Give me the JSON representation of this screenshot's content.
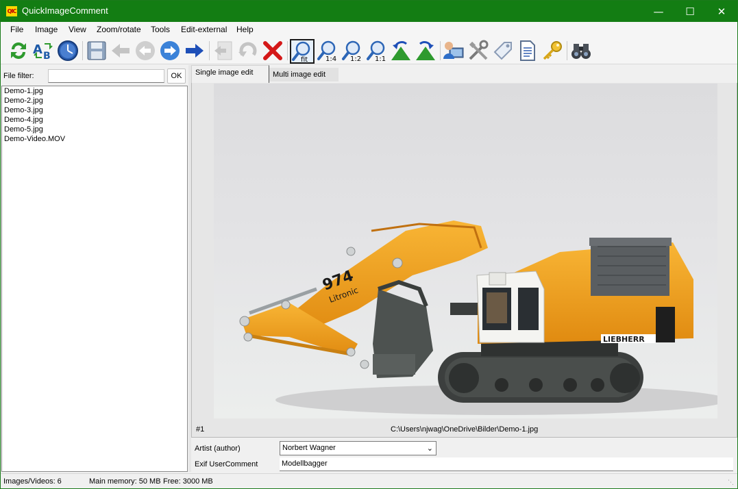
{
  "window": {
    "title": "QuickImageComment",
    "app_icon_text": "QIC",
    "minimize": "—",
    "maximize": "☐",
    "close": "✕"
  },
  "menu": {
    "items": [
      "File",
      "Image",
      "View",
      "Zoom/rotate",
      "Tools",
      "Edit-external",
      "Help"
    ]
  },
  "toolbar": {
    "buttons": [
      {
        "icon": "refresh-icon"
      },
      {
        "icon": "rename-icon"
      },
      {
        "icon": "clock-icon"
      },
      {
        "icon": "save-icon",
        "disabled": false
      },
      {
        "icon": "previous-arrow-icon",
        "disabled": true
      },
      {
        "icon": "previous-circle-icon",
        "disabled": true
      },
      {
        "icon": "next-circle-icon"
      },
      {
        "icon": "next-arrow-icon"
      },
      {
        "icon": "first-icon",
        "disabled": true
      },
      {
        "icon": "undo-icon",
        "disabled": true
      },
      {
        "icon": "delete-icon"
      },
      {
        "icon": "zoom-fit-icon",
        "label": "fit",
        "active": true
      },
      {
        "icon": "zoom-1-4-icon",
        "label": "1:4"
      },
      {
        "icon": "zoom-1-2-icon",
        "label": "1:2"
      },
      {
        "icon": "zoom-1-1-icon",
        "label": "1:1"
      },
      {
        "icon": "rotate-left-icon"
      },
      {
        "icon": "rotate-right-icon"
      },
      {
        "icon": "user-settings-icon"
      },
      {
        "icon": "tools-icon"
      },
      {
        "icon": "tag-icon"
      },
      {
        "icon": "document-icon"
      },
      {
        "icon": "key-icon"
      },
      {
        "icon": "binoculars-icon"
      }
    ]
  },
  "file_panel": {
    "filter_label": "File filter:",
    "filter_value": "",
    "ok_label": "OK",
    "files": [
      "Demo-1.jpg",
      "Demo-2.jpg",
      "Demo-3.jpg",
      "Demo-4.jpg",
      "Demo-5.jpg",
      "Demo-Video.MOV"
    ]
  },
  "tabs": {
    "single": "Single image edit",
    "multi": "Multi image edit"
  },
  "image": {
    "index": "#1",
    "path": "C:\\Users\\njwag\\OneDrive\\Bilder\\Demo-1.jpg",
    "print_main": "974",
    "print_sub": "Litronic",
    "brand": "LIEBHERR"
  },
  "fields": {
    "artist_label": "Artist (author)",
    "artist_value": "Norbert Wagner",
    "comment_label": "Exif UserComment",
    "comment_value": "Modellbagger"
  },
  "status": {
    "images": "Images/Videos: 6",
    "memory": "Main memory: 50 MB",
    "free": "Free: 3000 MB"
  },
  "colors": {
    "titlebar": "#137d13",
    "excavator_yellow": "#f0a01c",
    "track_gray": "#3c3f3e"
  }
}
